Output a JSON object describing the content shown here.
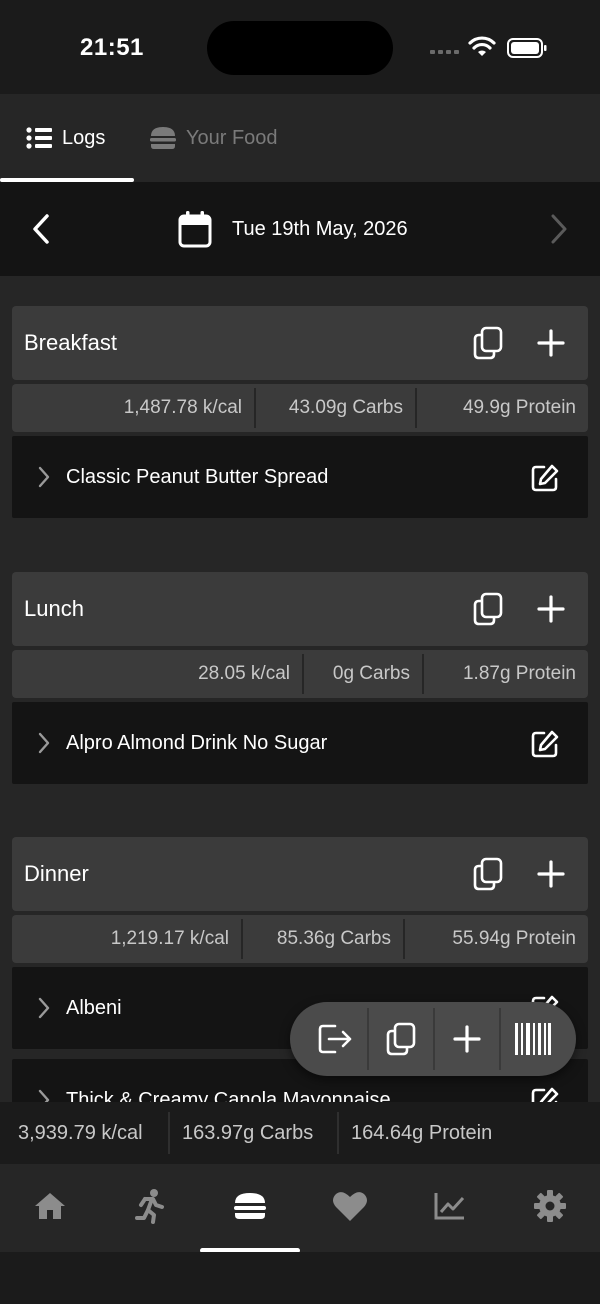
{
  "status_bar": {
    "time": "21:51"
  },
  "tabs": [
    {
      "label": "Logs",
      "icon": "list-icon",
      "active": true
    },
    {
      "label": "Your Food",
      "icon": "burger-icon",
      "active": false
    }
  ],
  "date_bar": {
    "date": "Tue 19th May, 2026"
  },
  "meals": [
    {
      "title": "Breakfast",
      "kcal": "1,487.78 k/cal",
      "carbs": "43.09g  Carbs",
      "protein": "49.9g  Protein",
      "items": [
        "Classic Peanut Butter Spread"
      ]
    },
    {
      "title": "Lunch",
      "kcal": "28.05 k/cal",
      "carbs": "0g  Carbs",
      "protein": "1.87g  Protein",
      "items": [
        "Alpro Almond Drink No Sugar"
      ]
    },
    {
      "title": "Dinner",
      "kcal": "1,219.17 k/cal",
      "carbs": "85.36g  Carbs",
      "protein": "55.94g  Protein",
      "items": [
        "Albeni",
        "Thick & Creamy Canola Mayonnaise"
      ]
    }
  ],
  "totals": {
    "kcal": "3,939.79 k/cal",
    "carbs": "163.97g  Carbs",
    "protein": "164.64g  Protein"
  },
  "fab_actions": [
    "export-icon",
    "copy-icon",
    "plus-icon",
    "barcode-icon"
  ],
  "bottom_nav": [
    "home-icon",
    "running-icon",
    "burger-icon",
    "heart-icon",
    "chart-icon",
    "gear-icon"
  ],
  "colors": {
    "background": "#262626",
    "card": "#3b3b3b",
    "item": "#141414",
    "text": "#ffffff",
    "muted": "#c8c8c8"
  }
}
